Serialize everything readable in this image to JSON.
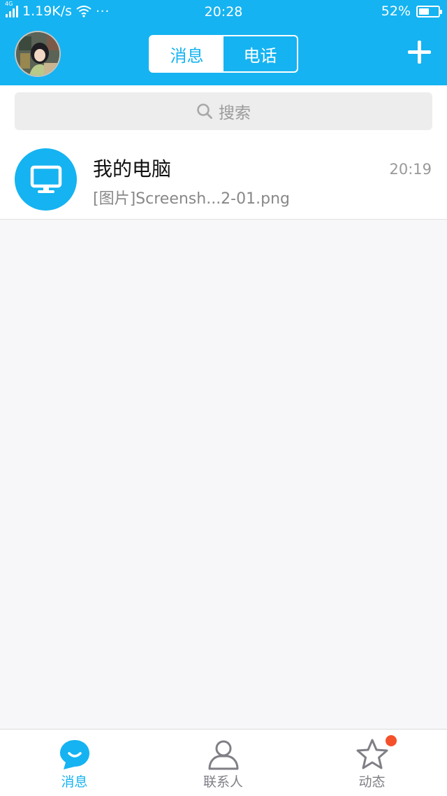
{
  "status_bar": {
    "network_type": "4G",
    "speed": "1.19K/s",
    "more": "···",
    "time": "20:28",
    "battery_percent": "52%",
    "battery_level": 0.52
  },
  "header": {
    "tabs": [
      {
        "label": "消息",
        "active": true
      },
      {
        "label": "电话",
        "active": false
      }
    ],
    "add_icon": "plus-icon"
  },
  "search": {
    "placeholder": "搜索"
  },
  "conversations": [
    {
      "name": "我的电脑",
      "time": "20:19",
      "preview": "[图片]Screensh...2-01.png",
      "icon": "monitor-icon"
    }
  ],
  "tabbar": {
    "items": [
      {
        "label": "消息",
        "icon": "chat-bubble-icon",
        "active": true
      },
      {
        "label": "联系人",
        "icon": "contacts-icon",
        "active": false
      },
      {
        "label": "动态",
        "icon": "star-icon",
        "active": false,
        "badge": true
      }
    ]
  },
  "colors": {
    "brand": "#15b3f1",
    "badge": "#f4512b"
  }
}
